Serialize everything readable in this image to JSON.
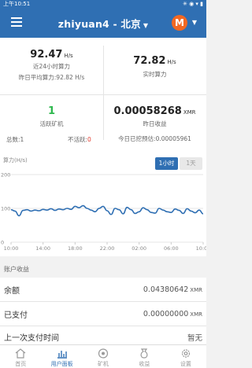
{
  "status_bar": {
    "time": "上午10:51",
    "icons": "✳ ◉ ▾ ▮"
  },
  "header": {
    "title": "zhiyuan4 - 北京",
    "coin_letter": "M"
  },
  "stats": {
    "hashrate_24h": {
      "value": "92.47",
      "unit": "H/s",
      "label": "近24小时算力",
      "yesterday_label": "昨日平均算力:",
      "yesterday_value": "92.82 H/s"
    },
    "realtime": {
      "value": "72.82",
      "unit": "H/s",
      "label": "实时算力"
    },
    "active_workers": {
      "value": "1",
      "label": "活跃矿机",
      "total_label": "总数:",
      "total_value": "1",
      "inactive_label": "不活跃:",
      "inactive_value": "0"
    },
    "yesterday_income": {
      "value": "0.00058268",
      "unit": "XMR",
      "label": "昨日收益",
      "estimate_label": "今日已挖预估:",
      "estimate_value": "0.00005961"
    }
  },
  "chart": {
    "title": "算力(H/s)",
    "tabs": {
      "active": "1小时",
      "inactive": "1天"
    },
    "y_ticks": [
      "200",
      "100",
      "0"
    ],
    "x_ticks": [
      "10:00",
      "14:00",
      "18:00",
      "22:00",
      "02:00",
      "06:00",
      "10:00"
    ]
  },
  "chart_data": {
    "type": "line",
    "ylabel": "算力(H/s)",
    "ylim": [
      0,
      200
    ],
    "x": [
      "10:00",
      "10:30",
      "11:00",
      "11:30",
      "12:00",
      "12:30",
      "13:00",
      "13:30",
      "14:00",
      "14:30",
      "15:00",
      "15:30",
      "16:00",
      "16:30",
      "17:00",
      "17:30",
      "18:00",
      "18:30",
      "19:00",
      "19:30",
      "20:00",
      "20:30",
      "21:00",
      "21:30",
      "22:00",
      "22:30",
      "23:00",
      "23:30",
      "00:00",
      "00:30",
      "01:00",
      "01:30",
      "02:00",
      "02:30",
      "03:00",
      "03:30",
      "04:00",
      "04:30",
      "05:00",
      "05:30",
      "06:00",
      "06:30",
      "07:00",
      "07:30",
      "08:00",
      "08:30",
      "09:00",
      "09:30",
      "10:00"
    ],
    "values": [
      96,
      92,
      78,
      94,
      96,
      92,
      95,
      93,
      97,
      95,
      99,
      94,
      98,
      96,
      100,
      97,
      106,
      102,
      108,
      100,
      95,
      90,
      100,
      106,
      93,
      82,
      100,
      96,
      84,
      103,
      96,
      85,
      90,
      102,
      96,
      88,
      86,
      100,
      95,
      90,
      88,
      98,
      94,
      85,
      99,
      92,
      87,
      95,
      84
    ]
  },
  "account": {
    "section_title": "账户收益",
    "balance_label": "余额",
    "balance_value": "0.04380642",
    "balance_unit": "XMR",
    "paid_label": "已支付",
    "paid_value": "0.00000000",
    "paid_unit": "XMR",
    "last_payment_label": "上一次支付时间",
    "last_payment_value": "暂无"
  },
  "tabbar": {
    "items": [
      {
        "label": "首页",
        "icon": "home-icon"
      },
      {
        "label": "用户面板",
        "icon": "dashboard-icon"
      },
      {
        "label": "矿机",
        "icon": "miner-icon"
      },
      {
        "label": "收益",
        "icon": "income-icon"
      },
      {
        "label": "设置",
        "icon": "gear-icon"
      }
    ]
  },
  "colors": {
    "primary": "#2f6fb3",
    "green": "#2db84d",
    "red": "#e23b2e",
    "monero": "#f26822"
  }
}
